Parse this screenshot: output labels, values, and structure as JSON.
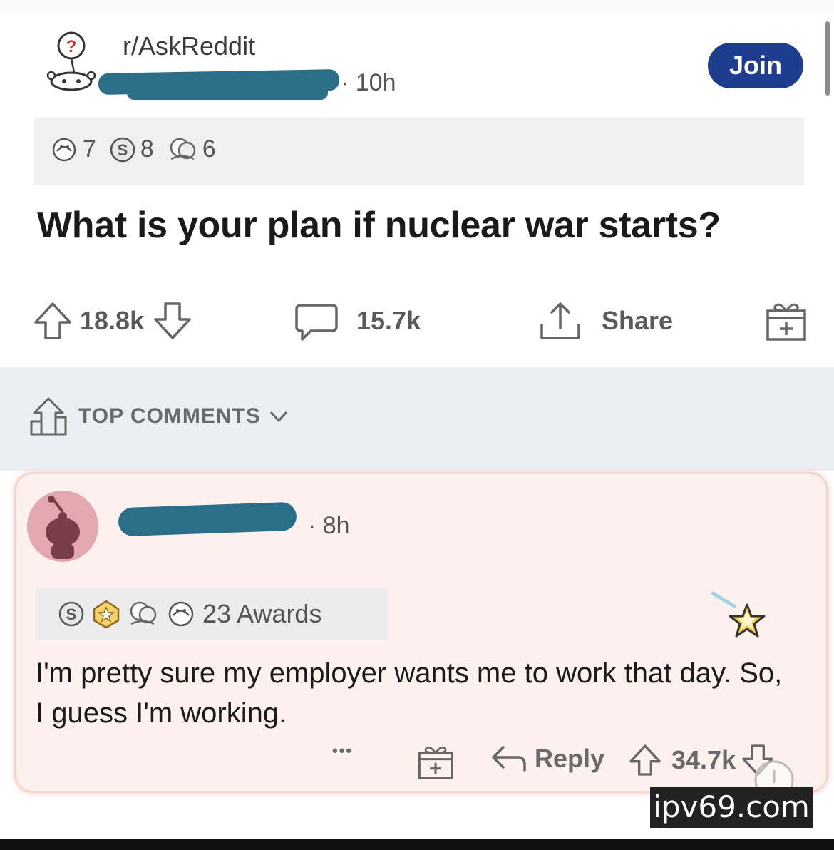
{
  "post": {
    "subreddit": "r/AskReddit",
    "time": "· 10h",
    "join_label": "Join",
    "awards": [
      {
        "icon": "helpful-award-icon",
        "count": "7"
      },
      {
        "icon": "silver-award-icon",
        "count": "8"
      },
      {
        "icon": "wholesome-award-icon",
        "count": "6"
      }
    ],
    "title": "What is your plan if nuclear war starts?",
    "upvotes": "18.8k",
    "comments": "15.7k",
    "share_label": "Share"
  },
  "sort": {
    "label": "TOP COMMENTS"
  },
  "comment": {
    "time": "· 8h",
    "awards_label": "23 Awards",
    "text": "I'm pretty sure my employer wants me to work that day. So, I guess I'm working.",
    "more": "•••",
    "reply_label": "Reply",
    "votes": "34.7k"
  },
  "watermark": "ipv69.com",
  "colors": {
    "join_button": "#1e3d8f",
    "redaction": "#2b6e8a",
    "comment_highlight": "#fdf1ee"
  }
}
